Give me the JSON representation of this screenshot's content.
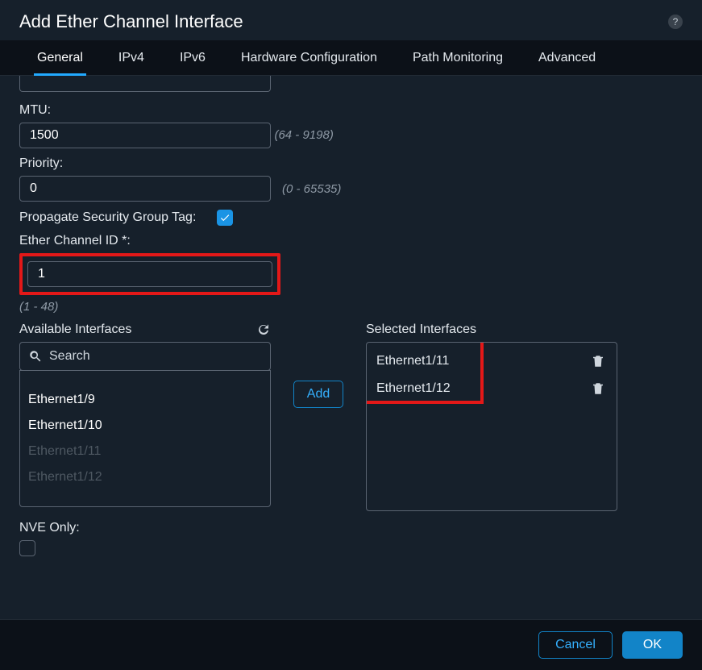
{
  "modal": {
    "title": "Add Ether Channel Interface"
  },
  "tabs": {
    "general": "General",
    "ipv4": "IPv4",
    "ipv6": "IPv6",
    "hardware": "Hardware Configuration",
    "path": "Path Monitoring",
    "advanced": "Advanced"
  },
  "fields": {
    "mtu_label": "MTU:",
    "mtu_value": "1500",
    "mtu_hint": "(64 - 9198)",
    "priority_label": "Priority:",
    "priority_value": "0",
    "priority_hint": "(0 - 65535)",
    "psgt_label": "Propagate Security Group Tag:",
    "psgt_checked": true,
    "eid_label": "Ether Channel ID *:",
    "eid_value": "1",
    "eid_hint": "(1 - 48)",
    "nve_label": "NVE Only:"
  },
  "transfer": {
    "available_header": "Available Interfaces",
    "selected_header": "Selected Interfaces",
    "search_placeholder": "Search",
    "add_label": "Add",
    "available": [
      {
        "label": "Ethernet1/9",
        "disabled": false
      },
      {
        "label": "Ethernet1/10",
        "disabled": false
      },
      {
        "label": "Ethernet1/11",
        "disabled": true
      },
      {
        "label": "Ethernet1/12",
        "disabled": true
      }
    ],
    "selected": [
      {
        "label": "Ethernet1/11"
      },
      {
        "label": "Ethernet1/12"
      }
    ]
  },
  "footer": {
    "cancel": "Cancel",
    "ok": "OK"
  }
}
